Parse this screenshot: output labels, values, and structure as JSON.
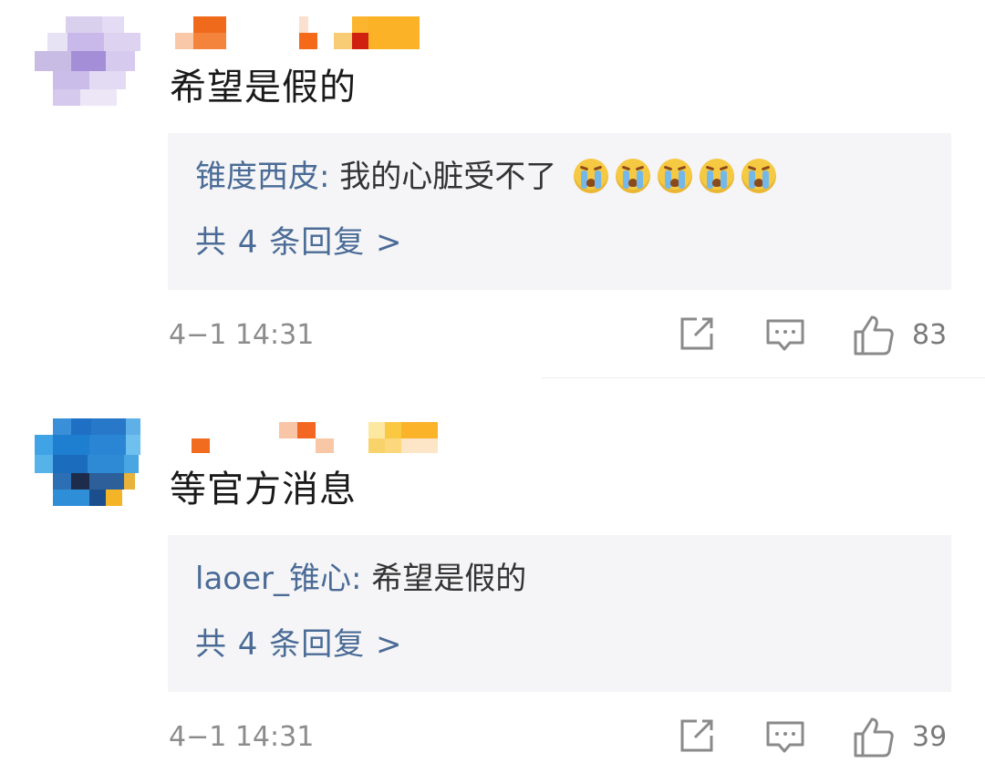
{
  "comments": [
    {
      "text": "希望是假的",
      "reply": {
        "author": "锥度西皮",
        "colon": ":",
        "text": "我的心脏受不了",
        "emoji_count": 5,
        "emoji_icon": "crying-face-icon"
      },
      "reply_count_label": "共 4 条回复 >",
      "time": "4−1 14:31",
      "likes": "83"
    },
    {
      "text": "等官方消息",
      "reply": {
        "author": "laoer_锥心",
        "colon": ":",
        "text": "希望是假的"
      },
      "reply_count_label": "共 4 条回复 >",
      "time": "4−1 14:31",
      "likes": "39"
    }
  ],
  "icons": {
    "share": "share-icon",
    "reply": "comment-icon",
    "like": "thumbs-up-icon"
  },
  "colors": {
    "link": "#4a6b96",
    "reply_bg": "#f5f5f7",
    "meta": "#8c8c8c"
  }
}
